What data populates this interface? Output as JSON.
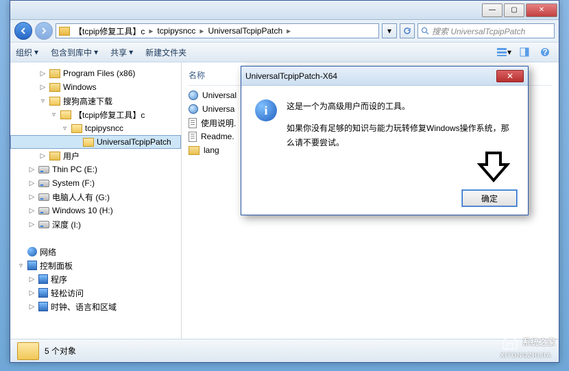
{
  "titlebar": {
    "min": "—",
    "max": "▢",
    "close": "✕"
  },
  "addr": {
    "crumbs": [
      "【tcpip修复工具】c",
      "tcpipysncc",
      "UniversalTcpipPatch"
    ],
    "sep": "▸",
    "search_placeholder": "搜索 UniversalTcpipPatch"
  },
  "toolbar": {
    "organize": "组织",
    "include": "包含到库中",
    "share": "共享",
    "newfolder": "新建文件夹"
  },
  "tree": [
    {
      "indent": 2,
      "toggle": "▷",
      "icon": "folder",
      "label": "Program Files (x86)"
    },
    {
      "indent": 2,
      "toggle": "▷",
      "icon": "folder",
      "label": "Windows"
    },
    {
      "indent": 2,
      "toggle": "▿",
      "icon": "folder-open",
      "label": "搜狗高速下载"
    },
    {
      "indent": 3,
      "toggle": "▿",
      "icon": "folder-open",
      "label": "【tcpip修复工具】c"
    },
    {
      "indent": 4,
      "toggle": "▿",
      "icon": "folder-open",
      "label": "tcpipysncc"
    },
    {
      "indent": 5,
      "toggle": "",
      "icon": "folder-open",
      "label": "UniversalTcpipPatch",
      "selected": true
    },
    {
      "indent": 2,
      "toggle": "▷",
      "icon": "folder",
      "label": "用户"
    },
    {
      "indent": 1,
      "toggle": "▷",
      "icon": "drive",
      "label": "Thin PC (E:)"
    },
    {
      "indent": 1,
      "toggle": "▷",
      "icon": "drive",
      "label": "System (F:)"
    },
    {
      "indent": 1,
      "toggle": "▷",
      "icon": "drive",
      "label": "电脑人人有 (G:)"
    },
    {
      "indent": 1,
      "toggle": "▷",
      "icon": "drive",
      "label": "Windows 10 (H:)"
    },
    {
      "indent": 1,
      "toggle": "▷",
      "icon": "drive",
      "label": "深度 (I:)"
    },
    {
      "indent": 0,
      "toggle": "",
      "icon": "",
      "label": ""
    },
    {
      "indent": 0,
      "toggle": "",
      "icon": "net",
      "label": "网络"
    },
    {
      "indent": 0,
      "toggle": "▿",
      "icon": "cp",
      "label": "控制面板"
    },
    {
      "indent": 1,
      "toggle": "▷",
      "icon": "cp",
      "label": "程序"
    },
    {
      "indent": 1,
      "toggle": "▷",
      "icon": "cp",
      "label": "轻松访问"
    },
    {
      "indent": 1,
      "toggle": "▷",
      "icon": "cp",
      "label": "时钟、语言和区域"
    }
  ],
  "content": {
    "col_name": "名称",
    "items": [
      {
        "icon": "html",
        "label": "Universal"
      },
      {
        "icon": "html",
        "label": "Universa"
      },
      {
        "icon": "txt",
        "label": "使用说明."
      },
      {
        "icon": "txt",
        "label": "Readme."
      },
      {
        "icon": "folder",
        "label": "lang"
      }
    ]
  },
  "status": {
    "text": "5 个对象"
  },
  "dialog": {
    "title": "UniversalTcpipPatch-X64",
    "line1": "这是一个为高级用户而设的工具。",
    "line2": "如果你没有足够的知识与能力玩转修复Windows操作系统，那么请不要尝试。",
    "ok": "确定",
    "close": "✕"
  },
  "watermark": {
    "brand": "系统之家",
    "sub": "XITONGZHIJIA"
  }
}
